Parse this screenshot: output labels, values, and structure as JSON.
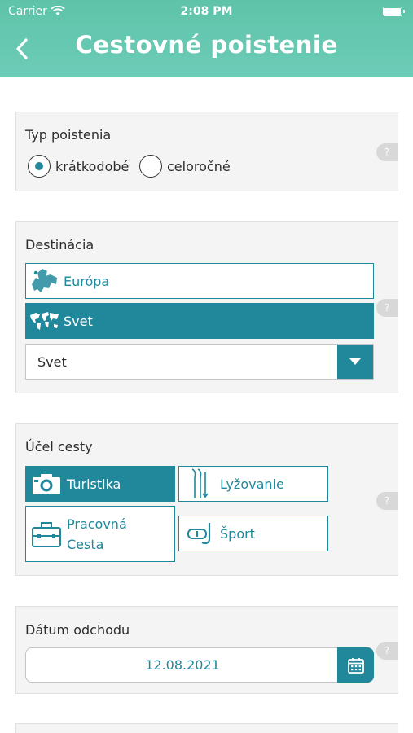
{
  "status_bar": {
    "carrier": "Carrier",
    "time": "2:08 PM"
  },
  "header": {
    "title": "Cestovné poistenie"
  },
  "insurance_type": {
    "label": "Typ poistenia",
    "options": [
      {
        "label": "krátkodobé",
        "selected": true
      },
      {
        "label": "celoročné",
        "selected": false
      }
    ],
    "help": "?"
  },
  "destination": {
    "label": "Destinácia",
    "options": [
      {
        "label": "Európa",
        "icon": "europe-map-icon",
        "active": false
      },
      {
        "label": "Svet",
        "icon": "world-map-icon",
        "active": true
      }
    ],
    "select_value": "Svet",
    "help": "?"
  },
  "trip_purpose": {
    "label": "Účel cesty",
    "options": [
      {
        "label": "Turistika",
        "icon": "camera-icon",
        "active": true
      },
      {
        "label": "Lyžovanie",
        "icon": "ski-icon",
        "active": false
      },
      {
        "label_line1": "Pracovná",
        "label_line2": "Cesta",
        "icon": "briefcase-icon",
        "active": false
      },
      {
        "label": "Šport",
        "icon": "snorkel-icon",
        "active": false
      }
    ],
    "help": "?"
  },
  "departure_date": {
    "label": "Dátum odchodu",
    "value": "12.08.2021",
    "icon": "calendar-icon",
    "help": "?"
  },
  "colors": {
    "accent": "#21889b",
    "header": "#5ec3a9"
  }
}
